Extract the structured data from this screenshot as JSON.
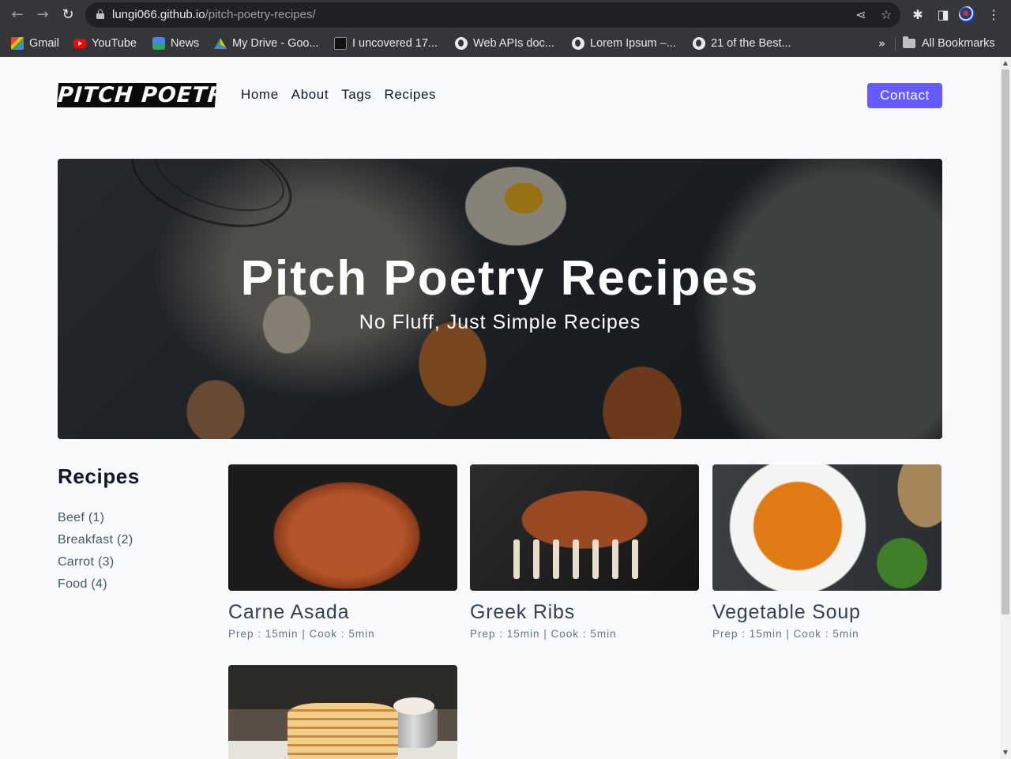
{
  "browser": {
    "url_host": "lungi066.github.io",
    "url_path": "/pitch-poetry-recipes/",
    "bookmarks": [
      {
        "label": "Gmail",
        "icon": "gmail-icon"
      },
      {
        "label": "YouTube",
        "icon": "youtube-icon"
      },
      {
        "label": "News",
        "icon": "news-icon"
      },
      {
        "label": "My Drive - Goo...",
        "icon": "drive-icon"
      },
      {
        "label": "I uncovered 17...",
        "icon": "site-icon"
      },
      {
        "label": "Web APIs doc...",
        "icon": "globe-icon"
      },
      {
        "label": "Lorem Ipsum –...",
        "icon": "globe-icon"
      },
      {
        "label": "21 of the Best...",
        "icon": "globe-icon"
      }
    ],
    "more": "»",
    "all_bookmarks": "All Bookmarks"
  },
  "site": {
    "logo": "PITCH POETRY",
    "nav": [
      "Home",
      "About",
      "Tags",
      "Recipes"
    ],
    "contact": "Contact"
  },
  "hero": {
    "title": "Pitch Poetry Recipes",
    "subtitle": "No Fluff, Just Simple Recipes"
  },
  "sidebar": {
    "title": "Recipes",
    "tags": [
      "Beef (1)",
      "Breakfast (2)",
      "Carrot (3)",
      "Food (4)"
    ]
  },
  "recipes": [
    {
      "title": "Carne Asada",
      "meta": "Prep : 15min | Cook : 5min"
    },
    {
      "title": "Greek Ribs",
      "meta": "Prep : 15min | Cook : 5min"
    },
    {
      "title": "Vegetable Soup",
      "meta": "Prep : 15min | Cook : 5min"
    },
    {
      "title": "",
      "meta": ""
    }
  ],
  "colors": {
    "accent": "#645cff",
    "chrome": "#35363a",
    "page_bg": "#f8fafc"
  }
}
